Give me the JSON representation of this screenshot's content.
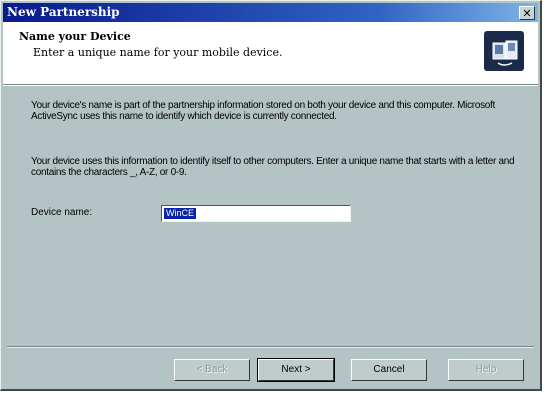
{
  "window": {
    "title": "New Partnership",
    "close_glyph": "✕"
  },
  "header": {
    "title": "Name your Device",
    "subtitle": "Enter a unique name for your mobile device.",
    "icon": "device-sync-icon"
  },
  "body": {
    "paragraph1": "Your device's name is part of the partnership information stored on both your device and this computer. Microsoft ActiveSync uses this name to identify which device is currently connected.",
    "paragraph2": "Your device uses this information to identify itself to other computers. Enter a unique name that starts with a letter and contains the characters _, A-Z, or 0-9."
  },
  "device_name": {
    "label": "Device name:",
    "value": "WinCE"
  },
  "buttons": {
    "back": "< Back",
    "next": "Next >",
    "cancel": "Cancel",
    "help": "Help"
  }
}
